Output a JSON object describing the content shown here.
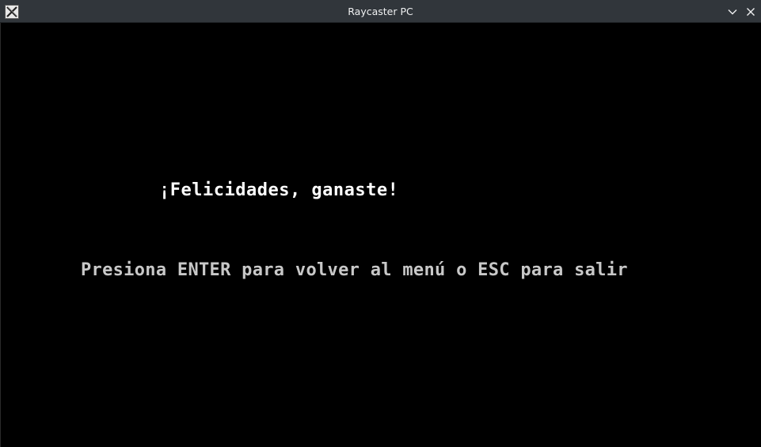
{
  "window": {
    "title": "Raycaster PC",
    "icons": {
      "app": "x11-app-icon",
      "minimize": "chevron-down-icon",
      "close": "close-icon"
    }
  },
  "game": {
    "win_message": "¡Felicidades, ganaste!",
    "instruction": "Presiona ENTER para volver al menú o ESC para salir",
    "colors": {
      "background": "#000000",
      "win_message": "#ffffff",
      "instruction": "#c8c8c8"
    }
  }
}
